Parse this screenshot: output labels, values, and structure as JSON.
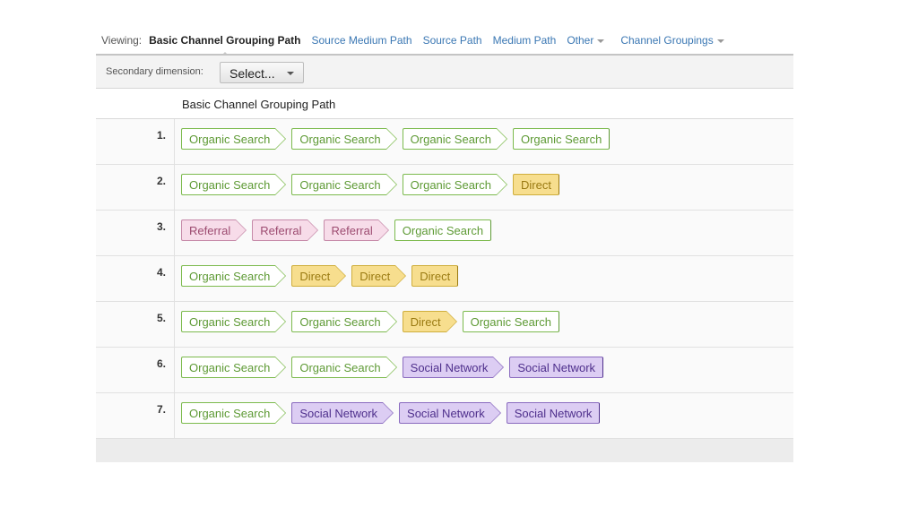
{
  "viewing": {
    "label": "Viewing:",
    "active": "Basic Channel Grouping Path",
    "links": [
      "Source Medium Path",
      "Source Path",
      "Medium Path"
    ],
    "dropdowns": [
      "Other",
      "Channel Groupings"
    ]
  },
  "secondary": {
    "label": "Secondary dimension:",
    "select_value": "Select..."
  },
  "table": {
    "header": "Basic Channel Grouping Path",
    "rows": [
      {
        "num": "1.",
        "path": [
          {
            "label": "Organic Search",
            "type": "organic"
          },
          {
            "label": "Organic Search",
            "type": "organic"
          },
          {
            "label": "Organic Search",
            "type": "organic"
          },
          {
            "label": "Organic Search",
            "type": "organic"
          }
        ]
      },
      {
        "num": "2.",
        "path": [
          {
            "label": "Organic Search",
            "type": "organic"
          },
          {
            "label": "Organic Search",
            "type": "organic"
          },
          {
            "label": "Organic Search",
            "type": "organic"
          },
          {
            "label": "Direct",
            "type": "direct"
          }
        ]
      },
      {
        "num": "3.",
        "path": [
          {
            "label": "Referral",
            "type": "referral"
          },
          {
            "label": "Referral",
            "type": "referral"
          },
          {
            "label": "Referral",
            "type": "referral"
          },
          {
            "label": "Organic Search",
            "type": "organic"
          }
        ]
      },
      {
        "num": "4.",
        "path": [
          {
            "label": "Organic Search",
            "type": "organic"
          },
          {
            "label": "Direct",
            "type": "direct"
          },
          {
            "label": "Direct",
            "type": "direct"
          },
          {
            "label": "Direct",
            "type": "direct"
          }
        ]
      },
      {
        "num": "5.",
        "path": [
          {
            "label": "Organic Search",
            "type": "organic"
          },
          {
            "label": "Organic Search",
            "type": "organic"
          },
          {
            "label": "Direct",
            "type": "direct"
          },
          {
            "label": "Organic Search",
            "type": "organic"
          }
        ]
      },
      {
        "num": "6.",
        "path": [
          {
            "label": "Organic Search",
            "type": "organic"
          },
          {
            "label": "Organic Search",
            "type": "organic"
          },
          {
            "label": "Social Network",
            "type": "social"
          },
          {
            "label": "Social Network",
            "type": "social"
          }
        ]
      },
      {
        "num": "7.",
        "path": [
          {
            "label": "Organic Search",
            "type": "organic"
          },
          {
            "label": "Social Network",
            "type": "social"
          },
          {
            "label": "Social Network",
            "type": "social"
          },
          {
            "label": "Social Network",
            "type": "social"
          }
        ]
      }
    ]
  },
  "colors": {
    "organic": "#7cba4d",
    "direct": "#f7de8e",
    "referral": "#f7dce9",
    "social": "#dccdf3",
    "link": "#3a77b3"
  }
}
